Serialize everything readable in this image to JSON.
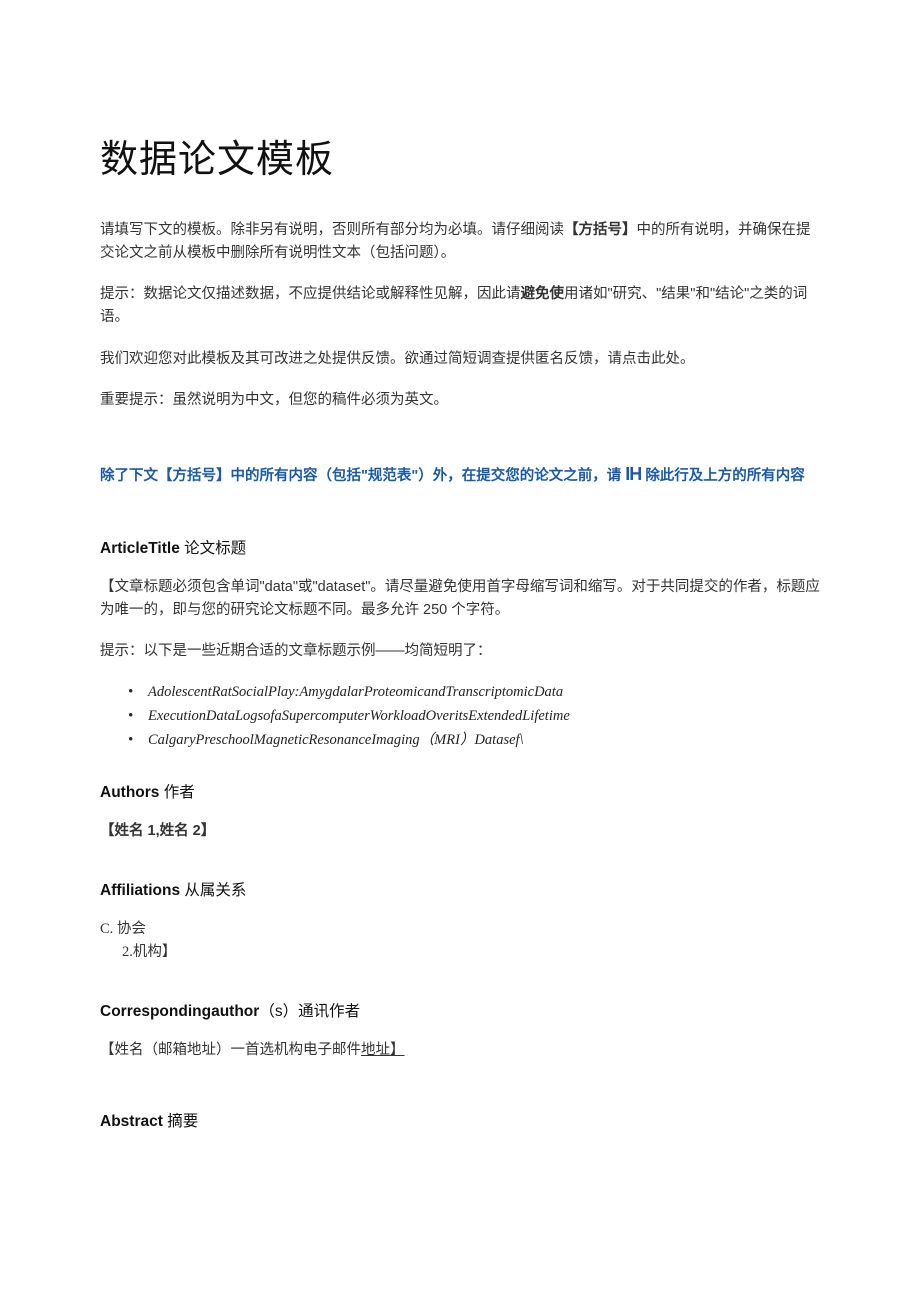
{
  "title": "数据论文模板",
  "p1": {
    "pre": "请填写下文的模板。除非另有说明，否则所有部分均为必填。请仔细阅读",
    "bracket": "【方括号】",
    "post": "中的所有说明，并确保在提交论文之前从模板中删除所有说明性文本（包括问题）。"
  },
  "p2": {
    "pre": "提示：数据论文仅描述数据，不应提供结论或解释性见解，因此请",
    "avoid": "避免使",
    "post": "用诸如\"研究、\"结果\"和\"结论\"之类的词语。"
  },
  "p3": "我们欢迎您对此模板及其可改进之处提供反馈。欲通过简短调查提供匿名反馈，请点击此处。",
  "p4": "重要提示：虽然说明为中文，但您的稿件必须为英文。",
  "remove_notice": {
    "pre": "除了下文",
    "bracket": "【方括号】",
    "mid": "中的所有内容（包括\"规范表\"）外，在提交您的论文之前，请",
    "token": "IH",
    "post": "除此行及上方的所有内容"
  },
  "sections": {
    "article_title": {
      "en": "ArticleTitle",
      "cn": " 论文标题",
      "note": "【文章标题必须包含单词\"data\"或\"dataset\"。请尽量避免使用首字母缩写词和缩写。对于共同提交的作者，标题应为唯一的，即与您的研究论文标题不同。最多允许 250 个字符。",
      "tip": "提示：以下是一些近期合适的文章标题示例——均简短明了：",
      "examples": [
        "AdolescentRatSocialPlay:AmygdalarProteomicandTranscriptomicData",
        "ExecutionDataLogsofaSupercomputerWorkloadOveritsExtendedLifetime",
        "CalgaryPreschoolMagneticResonanceImaging（MRI）Datasef\\"
      ]
    },
    "authors": {
      "en": "Authors",
      "cn": " 作者",
      "content": "【姓名 1,姓名 2】"
    },
    "affiliations": {
      "en": "Affiliations",
      "cn": " 从属关系",
      "line1": "C. 协会",
      "line2": "2.机构】"
    },
    "corresponding": {
      "en": "Correspondingauthor",
      "paren": "（s）",
      "cn": "通讯作者",
      "content_pre": "【姓名（邮箱地址）一首选机构电子邮件",
      "content_ul": "地址】"
    },
    "abstract": {
      "en": "Abstract",
      "cn": " 摘要"
    }
  }
}
